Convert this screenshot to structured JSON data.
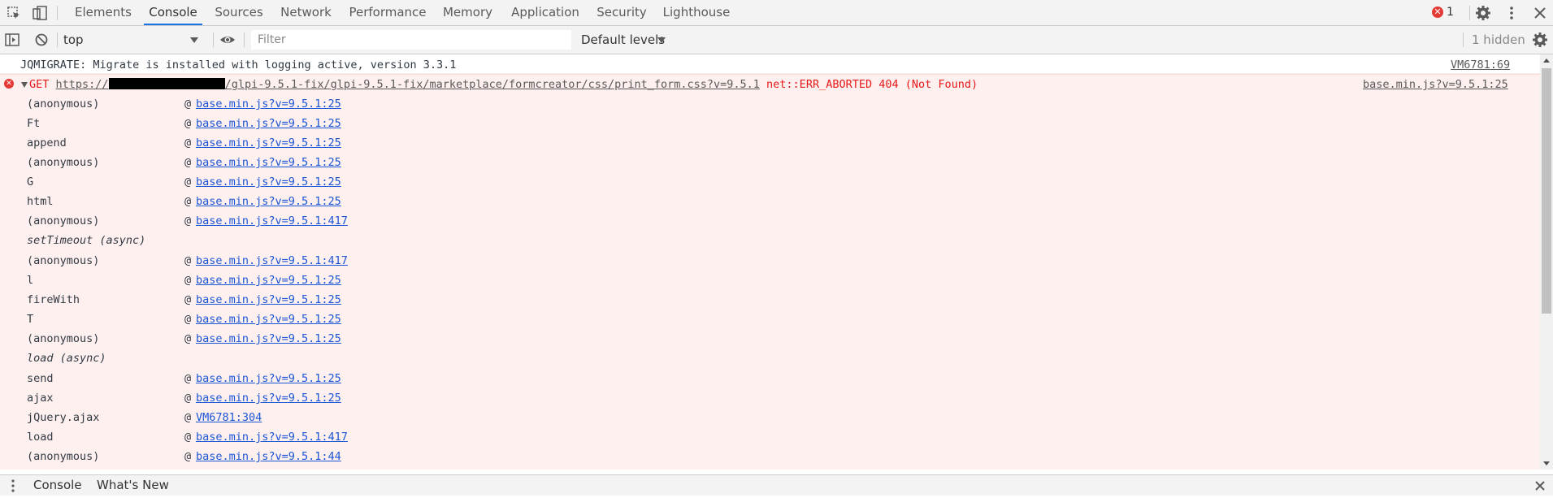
{
  "tabbar": {
    "tabs": [
      {
        "label": "Elements"
      },
      {
        "label": "Console",
        "active": true
      },
      {
        "label": "Sources"
      },
      {
        "label": "Network"
      },
      {
        "label": "Performance"
      },
      {
        "label": "Memory"
      },
      {
        "label": "Application"
      },
      {
        "label": "Security"
      },
      {
        "label": "Lighthouse"
      }
    ],
    "error_count": "1",
    "icons": [
      "inspect-element-icon",
      "device-toolbar-icon",
      "error-icon",
      "settings-icon",
      "more-options-icon",
      "close-icon"
    ]
  },
  "toolbar": {
    "context": "top",
    "filter_placeholder": "Filter",
    "levels_label": "Default levels",
    "hidden_label": "1 hidden",
    "icons": [
      "sidebar-toggle-icon",
      "clear-console-icon",
      "live-expression-icon",
      "console-settings-icon"
    ]
  },
  "console": {
    "info": {
      "text": "JQMIGRATE: Migrate is installed with logging active, version 3.3.1",
      "source": "VM6781:69"
    },
    "error": {
      "method": "GET",
      "url_prefix": "https://",
      "url_path": "/glpi-9.5.1-fix/glpi-9.5.1-fix/marketplace/formcreator/css/print_form.css?v=9.5.1",
      "message": "net::ERR_ABORTED 404 (Not Found)",
      "source": "base.min.js?v=9.5.1:25"
    },
    "at_symbol": "@",
    "stack": [
      {
        "fn": "(anonymous)",
        "loc": "base.min.js?v=9.5.1:25"
      },
      {
        "fn": "Ft",
        "loc": "base.min.js?v=9.5.1:25"
      },
      {
        "fn": "append",
        "loc": "base.min.js?v=9.5.1:25"
      },
      {
        "fn": "(anonymous)",
        "loc": "base.min.js?v=9.5.1:25"
      },
      {
        "fn": "G",
        "loc": "base.min.js?v=9.5.1:25"
      },
      {
        "fn": "html",
        "loc": "base.min.js?v=9.5.1:25"
      },
      {
        "fn": "(anonymous)",
        "loc": "base.min.js?v=9.5.1:417"
      },
      {
        "fn": "setTimeout (async)",
        "async": true
      },
      {
        "fn": "(anonymous)",
        "loc": "base.min.js?v=9.5.1:417"
      },
      {
        "fn": "l",
        "loc": "base.min.js?v=9.5.1:25"
      },
      {
        "fn": "fireWith",
        "loc": "base.min.js?v=9.5.1:25"
      },
      {
        "fn": "T",
        "loc": "base.min.js?v=9.5.1:25"
      },
      {
        "fn": "(anonymous)",
        "loc": "base.min.js?v=9.5.1:25"
      },
      {
        "fn": "load (async)",
        "async": true
      },
      {
        "fn": "send",
        "loc": "base.min.js?v=9.5.1:25"
      },
      {
        "fn": "ajax",
        "loc": "base.min.js?v=9.5.1:25"
      },
      {
        "fn": "jQuery.ajax",
        "loc": "VM6781:304"
      },
      {
        "fn": "load",
        "loc": "base.min.js?v=9.5.1:417"
      },
      {
        "fn": "(anonymous)",
        "loc": "base.min.js?v=9.5.1:44"
      }
    ]
  },
  "drawer": {
    "tabs": [
      {
        "label": "Console"
      },
      {
        "label": "What's New"
      }
    ],
    "icons": [
      "drawer-menu-icon",
      "drawer-close-icon"
    ]
  }
}
